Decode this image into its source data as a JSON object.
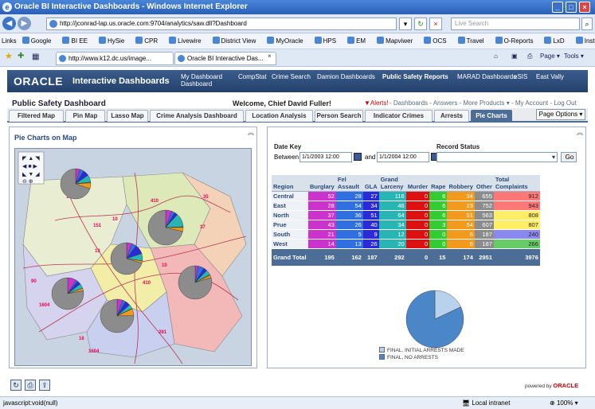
{
  "window": {
    "title": "Oracle BI Interactive Dashboards - Windows Internet Explorer"
  },
  "browser": {
    "url": "http://jconrad-lap.us.oracle.com:9704/analytics/saw.dll?Dashboard",
    "search_placeholder": "Live Search",
    "links_label": "Links",
    "links": [
      "Google",
      "BI EE",
      "HySie",
      "CPR",
      "Livewire",
      "District View",
      "MyOracle",
      "HPS",
      "EM",
      "Mapviwer",
      "OCS",
      "Travel",
      "O-Reports",
      "LxD",
      "Install orcl"
    ],
    "tabs": [
      "http://www.k12.dc.us/image...",
      "Oracle BI Interactive Das..."
    ],
    "tools": {
      "page": "Page",
      "tools": "Tools"
    }
  },
  "obi": {
    "logo": "ORACLE",
    "app": "Interactive Dashboards",
    "nav": [
      {
        "label": "My Dashboard",
        "label2": "Dashboard"
      },
      {
        "label": "CompStat"
      },
      {
        "label": "Crime Search"
      },
      {
        "label": "Damion Dashboards"
      },
      {
        "label": "Public Safety Reports"
      },
      {
        "label": "MARAD Dashboards"
      },
      {
        "label": "eSIS"
      },
      {
        "label": "East Vally"
      }
    ]
  },
  "header": {
    "title": "Public Safety Dashboard",
    "welcome": "Welcome, Chief David Fuller!",
    "alerts": "Alerts!",
    "links": [
      "Dashboards",
      "Answers",
      "More Products",
      "My Account",
      "Log Out"
    ]
  },
  "dash_tabs": [
    "Filtered Map",
    "Pin Map",
    "Lasso Map",
    "Crime Analysis Dashboard",
    "Location Analysis",
    "Person Search",
    "Indicator Crimes",
    "Arrests",
    "Pie Charts"
  ],
  "page_options": "Page Options",
  "left_panel": {
    "title": "Pie Charts on Map",
    "map_labels": [
      "1604",
      "410",
      "35",
      "151",
      "10",
      "37",
      "90",
      "13",
      "1604",
      "1604",
      "410",
      "10",
      "16",
      "281"
    ]
  },
  "right_panel": {
    "date_key": "Date Key",
    "between": "Between",
    "and": "and",
    "date_from": "1/1/2003 12:00",
    "date_to": "1/1/2004 12:00",
    "record_status": "Record Status",
    "go": "Go",
    "legend": [
      "FINAL, INITIAL ARRESTS MADE",
      "FINAL, NO ARRESTS"
    ]
  },
  "table": {
    "headers": [
      "Region",
      "Burglary",
      "Fel Assault",
      "GLA",
      "Grand Larceny",
      "Murder",
      "Rape",
      "Robbery",
      "Other",
      "Total Complaints"
    ],
    "rows": [
      [
        "Central",
        "52",
        "28",
        "27",
        "116",
        "0",
        "6",
        "34",
        "655",
        "912"
      ],
      [
        "East",
        "28",
        "54",
        "34",
        "46",
        "0",
        "6",
        "23",
        "752",
        "943"
      ],
      [
        "North",
        "37",
        "36",
        "51",
        "64",
        "0",
        "6",
        "51",
        "563",
        "808"
      ],
      [
        "Prue",
        "43",
        "26",
        "40",
        "34",
        "0",
        "3",
        "54",
        "607",
        "807"
      ],
      [
        "South",
        "21",
        "5",
        "9",
        "12",
        "0",
        "0",
        "6",
        "187",
        "240"
      ],
      [
        "West",
        "14",
        "13",
        "26",
        "20",
        "0",
        "0",
        "6",
        "187",
        "266"
      ]
    ],
    "total": [
      "Grand Total",
      "195",
      "162",
      "187",
      "292",
      "0",
      "15",
      "174",
      "2951",
      "3976"
    ]
  },
  "chart_data": {
    "type": "pie",
    "categories": [
      "FINAL, INITIAL ARRESTS MADE",
      "FINAL, NO ARRESTS"
    ],
    "values": [
      18,
      82
    ],
    "colors": [
      "#b8d2ee",
      "#4a86c8"
    ]
  },
  "colors": {
    "burglary": "#cc33cc",
    "felassault": "#2f6fe0",
    "gla": "#2a2ad8",
    "larceny": "#2ab5b5",
    "murder": "#dd1111",
    "rape": "#33cc33",
    "robbery": "#f29a1b",
    "other": "#8c8c8c",
    "total_high": "#ff7777",
    "total_mid": "#ffee66",
    "total_low": "#66cc66",
    "total_lowest": "#8a8aee"
  },
  "footer": {
    "powered_by": "powered by",
    "oracle": "ORACLE"
  },
  "status": {
    "text": "javascript:void(null)",
    "zone": "Local intranet",
    "zoom": "100%"
  }
}
